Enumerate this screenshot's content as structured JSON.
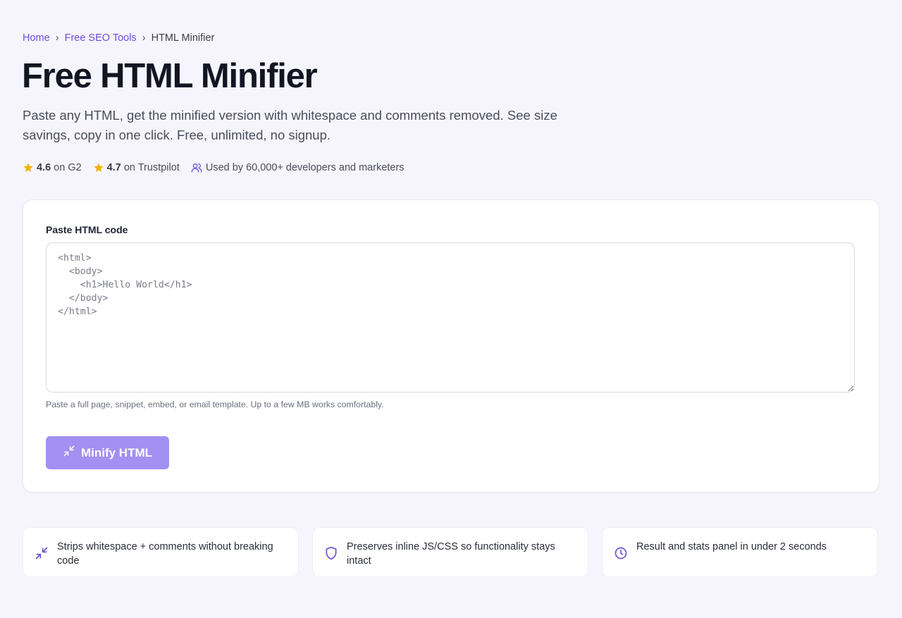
{
  "breadcrumb": {
    "home": "Home",
    "section": "Free SEO Tools",
    "current": "HTML Minifier",
    "separator": "›"
  },
  "page_title": "Free HTML Minifier",
  "subtitle": "Paste any HTML, get the minified version with whitespace and comments removed. See size savings, copy in one click. Free, unlimited, no signup.",
  "ratings": {
    "g2": {
      "score": "4.6",
      "label": "on G2"
    },
    "trustpilot": {
      "score": "4.7",
      "label": "on Trustpilot"
    },
    "users": "Used by 60,000+ developers and marketers"
  },
  "form": {
    "label": "Paste HTML code",
    "code_value": "<html>\n  <body>\n    <h1>Hello World</h1>\n  </body>\n</html>",
    "hint": "Paste a full page, snippet, embed, or email template. Up to a few MB works comfortably.",
    "button_label": "Minify HTML"
  },
  "features": [
    {
      "icon": "minimize-icon",
      "text": "Strips whitespace + comments without breaking code"
    },
    {
      "icon": "shield-icon",
      "text": "Preserves inline JS/CSS so functionality stays intact"
    },
    {
      "icon": "clock-icon",
      "text": "Result and stats panel in under 2 seconds"
    }
  ],
  "colors": {
    "accent": "#6b4fd8",
    "button": "#a290f2",
    "star": "#f0b400",
    "background": "#f6f5fd"
  }
}
